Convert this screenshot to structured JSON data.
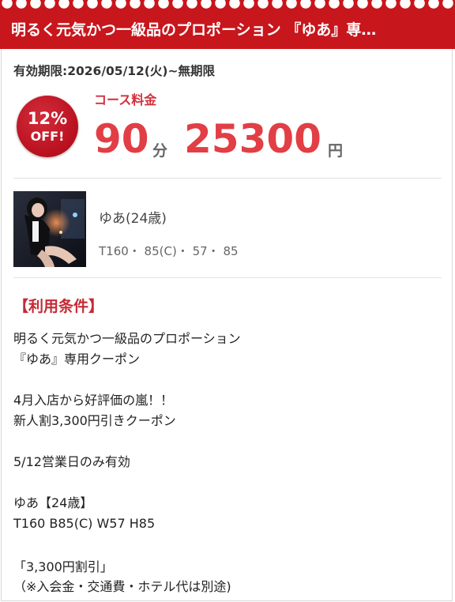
{
  "header": {
    "title": "明るく元気かつ一級品のプロポーション 『ゆあ』専…"
  },
  "coupon": {
    "validity": "有効期限:2026/05/12(火)~無期限",
    "badge_percent": "12%",
    "badge_off": "OFF!",
    "course_label": "コース料金",
    "minutes": "90",
    "minutes_unit": "分",
    "price": "25300",
    "price_unit": "円"
  },
  "profile": {
    "name": "ゆあ(24歳)",
    "measurements": "T160・ 85(C)・ 57・ 85"
  },
  "conditions": {
    "title": "【利用条件】",
    "lines": [
      "明るく元気かつ一級品のプロポーション",
      "『ゆあ』専用クーポン",
      "4月入店から好評価の嵐！！",
      "新人割3,300円引きクーポン",
      "5/12営業日のみ有効",
      "ゆあ【24歳】",
      "T160 B85(C) W57 H85",
      "「3,300円割引」",
      "（※入会金・交通費・ホテル代は別途)"
    ]
  },
  "colors": {
    "brand_red": "#c8161d",
    "price_red": "#e23e45"
  },
  "icons": {
    "badge": "discount-badge"
  }
}
